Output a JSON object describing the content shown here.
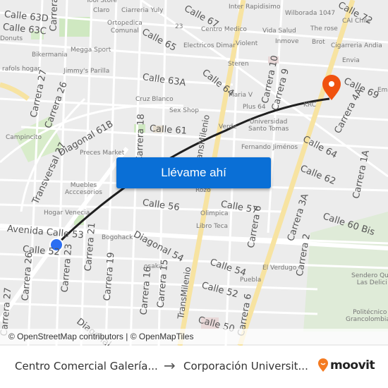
{
  "map": {
    "streets": [
      {
        "id": "calle-63d",
        "text": "Calle 63D"
      },
      {
        "id": "calle-63c",
        "text": "Calle 63C"
      },
      {
        "id": "carrera-top",
        "text": "Carrera"
      },
      {
        "id": "calle-65",
        "text": "Calle 65"
      },
      {
        "id": "calle-67",
        "text": "Calle 67"
      },
      {
        "id": "calle-72",
        "text": "Calle 72"
      },
      {
        "id": "calle-63a",
        "text": "Calle 63A"
      },
      {
        "id": "carrera-27",
        "text": "Carrera 27"
      },
      {
        "id": "carrera-26-top",
        "text": "Carrera 26"
      },
      {
        "id": "calle-64",
        "text": "Calle 64"
      },
      {
        "id": "carrera-10",
        "text": "Carrera 10"
      },
      {
        "id": "carrera-9",
        "text": "Carrera 9"
      },
      {
        "id": "calle-69",
        "text": "Calle 69"
      },
      {
        "id": "carrera-4a",
        "text": "Carrera 4A"
      },
      {
        "id": "diagonal-61b",
        "text": "Diagonal 61B"
      },
      {
        "id": "calle-61",
        "text": "Calle 61"
      },
      {
        "id": "transmilenio-top",
        "text": "TransMilenio"
      },
      {
        "id": "calle-64-right",
        "text": "Calle 64"
      },
      {
        "id": "calle-62",
        "text": "Calle 62"
      },
      {
        "id": "carrera-1a",
        "text": "Carrera 1A"
      },
      {
        "id": "carrera-18",
        "text": "Carrera 18"
      },
      {
        "id": "transversal-27",
        "text": "Transversal 27"
      },
      {
        "id": "calle-56",
        "text": "Calle 56"
      },
      {
        "id": "calle-57",
        "text": "Calle 57"
      },
      {
        "id": "carrera-3a",
        "text": "Carrera 3A"
      },
      {
        "id": "calle-60-bis",
        "text": "Calle 60 Bis"
      },
      {
        "id": "avenida-calle-53",
        "text": "Avenida Calle 53"
      },
      {
        "id": "calle-52-left",
        "text": "Calle 52"
      },
      {
        "id": "diagonal-54",
        "text": "Diagonal 54"
      },
      {
        "id": "carrera-6",
        "text": "Carrera 6"
      },
      {
        "id": "carrera-2",
        "text": "Carrera 2"
      },
      {
        "id": "calle-54",
        "text": "Calle 54"
      },
      {
        "id": "carrera-26",
        "text": "Carrera 26"
      },
      {
        "id": "carrera-23",
        "text": "Carrera 23"
      },
      {
        "id": "carrera-21",
        "text": "Carrera 21"
      },
      {
        "id": "carrera-19",
        "text": "Carrera 19"
      },
      {
        "id": "carrera-16",
        "text": "Carrera 16"
      },
      {
        "id": "carrera-15",
        "text": "Carrera 15"
      },
      {
        "id": "transmilenio-bottom",
        "text": "TransMilenio"
      },
      {
        "id": "calle-52",
        "text": "Calle 52"
      },
      {
        "id": "calle-50",
        "text": "Calle 50"
      },
      {
        "id": "carrera-6-bottom",
        "text": "Carrera 6"
      },
      {
        "id": "carrera-27-bottom",
        "text": "Carrera 27"
      },
      {
        "id": "diagonal-bottom",
        "text": "Diagonal"
      }
    ],
    "pois": [
      {
        "id": "tool-store",
        "text": "Tool Store"
      },
      {
        "id": "claro",
        "text": "Claro"
      },
      {
        "id": "ciarreria-yuly",
        "text": "Ciarreria Yuly"
      },
      {
        "id": "ortopedica-comunal",
        "text": "Ortopedica\nComunal"
      },
      {
        "id": "donuts",
        "text": "Donuts"
      },
      {
        "id": "megga-sport",
        "text": "Megga Sport"
      },
      {
        "id": "bikermania",
        "text": "Bikermania"
      },
      {
        "id": "rafols-hogar",
        "text": "rafols hogar"
      },
      {
        "id": "jimmys-parilla",
        "text": "Jimmy's Parilla"
      },
      {
        "id": "num-23",
        "text": "23"
      },
      {
        "id": "electricos-dimar",
        "text": "Electricos Dimar"
      },
      {
        "id": "inter-rapidisimo",
        "text": "Inter Rapidisimo"
      },
      {
        "id": "wilborada",
        "text": "Wilborada 1047"
      },
      {
        "id": "centro-medico",
        "text": "Centro Medico"
      },
      {
        "id": "vida-salud",
        "text": "Vida Salud"
      },
      {
        "id": "cai-chile",
        "text": "CAI Chile"
      },
      {
        "id": "the-rose",
        "text": "The rose"
      },
      {
        "id": "violent",
        "text": "Violent"
      },
      {
        "id": "inmove",
        "text": "Inmove"
      },
      {
        "id": "brot",
        "text": "Brot"
      },
      {
        "id": "cigarreria-andia",
        "text": "Cigarreria Andia"
      },
      {
        "id": "steren",
        "text": "Steren"
      },
      {
        "id": "envia",
        "text": "Envia"
      },
      {
        "id": "maria-v",
        "text": "Maria V"
      },
      {
        "id": "ema",
        "text": "Ema"
      },
      {
        "id": "cruz-blanco",
        "text": "Cruz Blanco"
      },
      {
        "id": "sex-shop",
        "text": "Sex Shop"
      },
      {
        "id": "plus-64",
        "text": "Plus 64"
      },
      {
        "id": "krc",
        "text": "KRC"
      },
      {
        "id": "campincito",
        "text": "Campincito"
      },
      {
        "id": "verde",
        "text": "Verde"
      },
      {
        "id": "universidad-santo-tomas",
        "text": "Universidad\nSanto Tomas"
      },
      {
        "id": "preces-market",
        "text": "Preces Market"
      },
      {
        "id": "fernando-jimenos",
        "text": "Fernando Jiménos"
      },
      {
        "id": "muebles-accesorios",
        "text": "Muebles\nAcccesorios"
      },
      {
        "id": "rozo",
        "text": "Rozo"
      },
      {
        "id": "hogar-venecia",
        "text": "Hogar Venecia"
      },
      {
        "id": "olimpica",
        "text": "Olimpica"
      },
      {
        "id": "libro-teca",
        "text": "Libro Teca"
      },
      {
        "id": "bogohack",
        "text": "Bogohack"
      },
      {
        "id": "osaka",
        "text": "osaka"
      },
      {
        "id": "el-verdugo",
        "text": "El Verdugo"
      },
      {
        "id": "puebla",
        "text": "Puebla"
      },
      {
        "id": "sendero",
        "text": "Sendero Que\nLas Delici"
      },
      {
        "id": "politecnico",
        "text": "Politécnico\nGrancolombian"
      }
    ],
    "cta_label": "Llévame ahí",
    "attribution": "© OpenStreetMap contributors | © OpenMapTiles",
    "colors": {
      "route": "#1f1f1f",
      "origin": "#2b6ef2",
      "destination": "#f0520f",
      "cta": "#0a6fd6",
      "major_road": "#f7e3a1",
      "park": "#cfe8c1"
    }
  },
  "footer": {
    "from": "Centro Comercial Galería...",
    "arrow": "→",
    "to": "Corporación Universit...",
    "logo_text": "moovit"
  }
}
